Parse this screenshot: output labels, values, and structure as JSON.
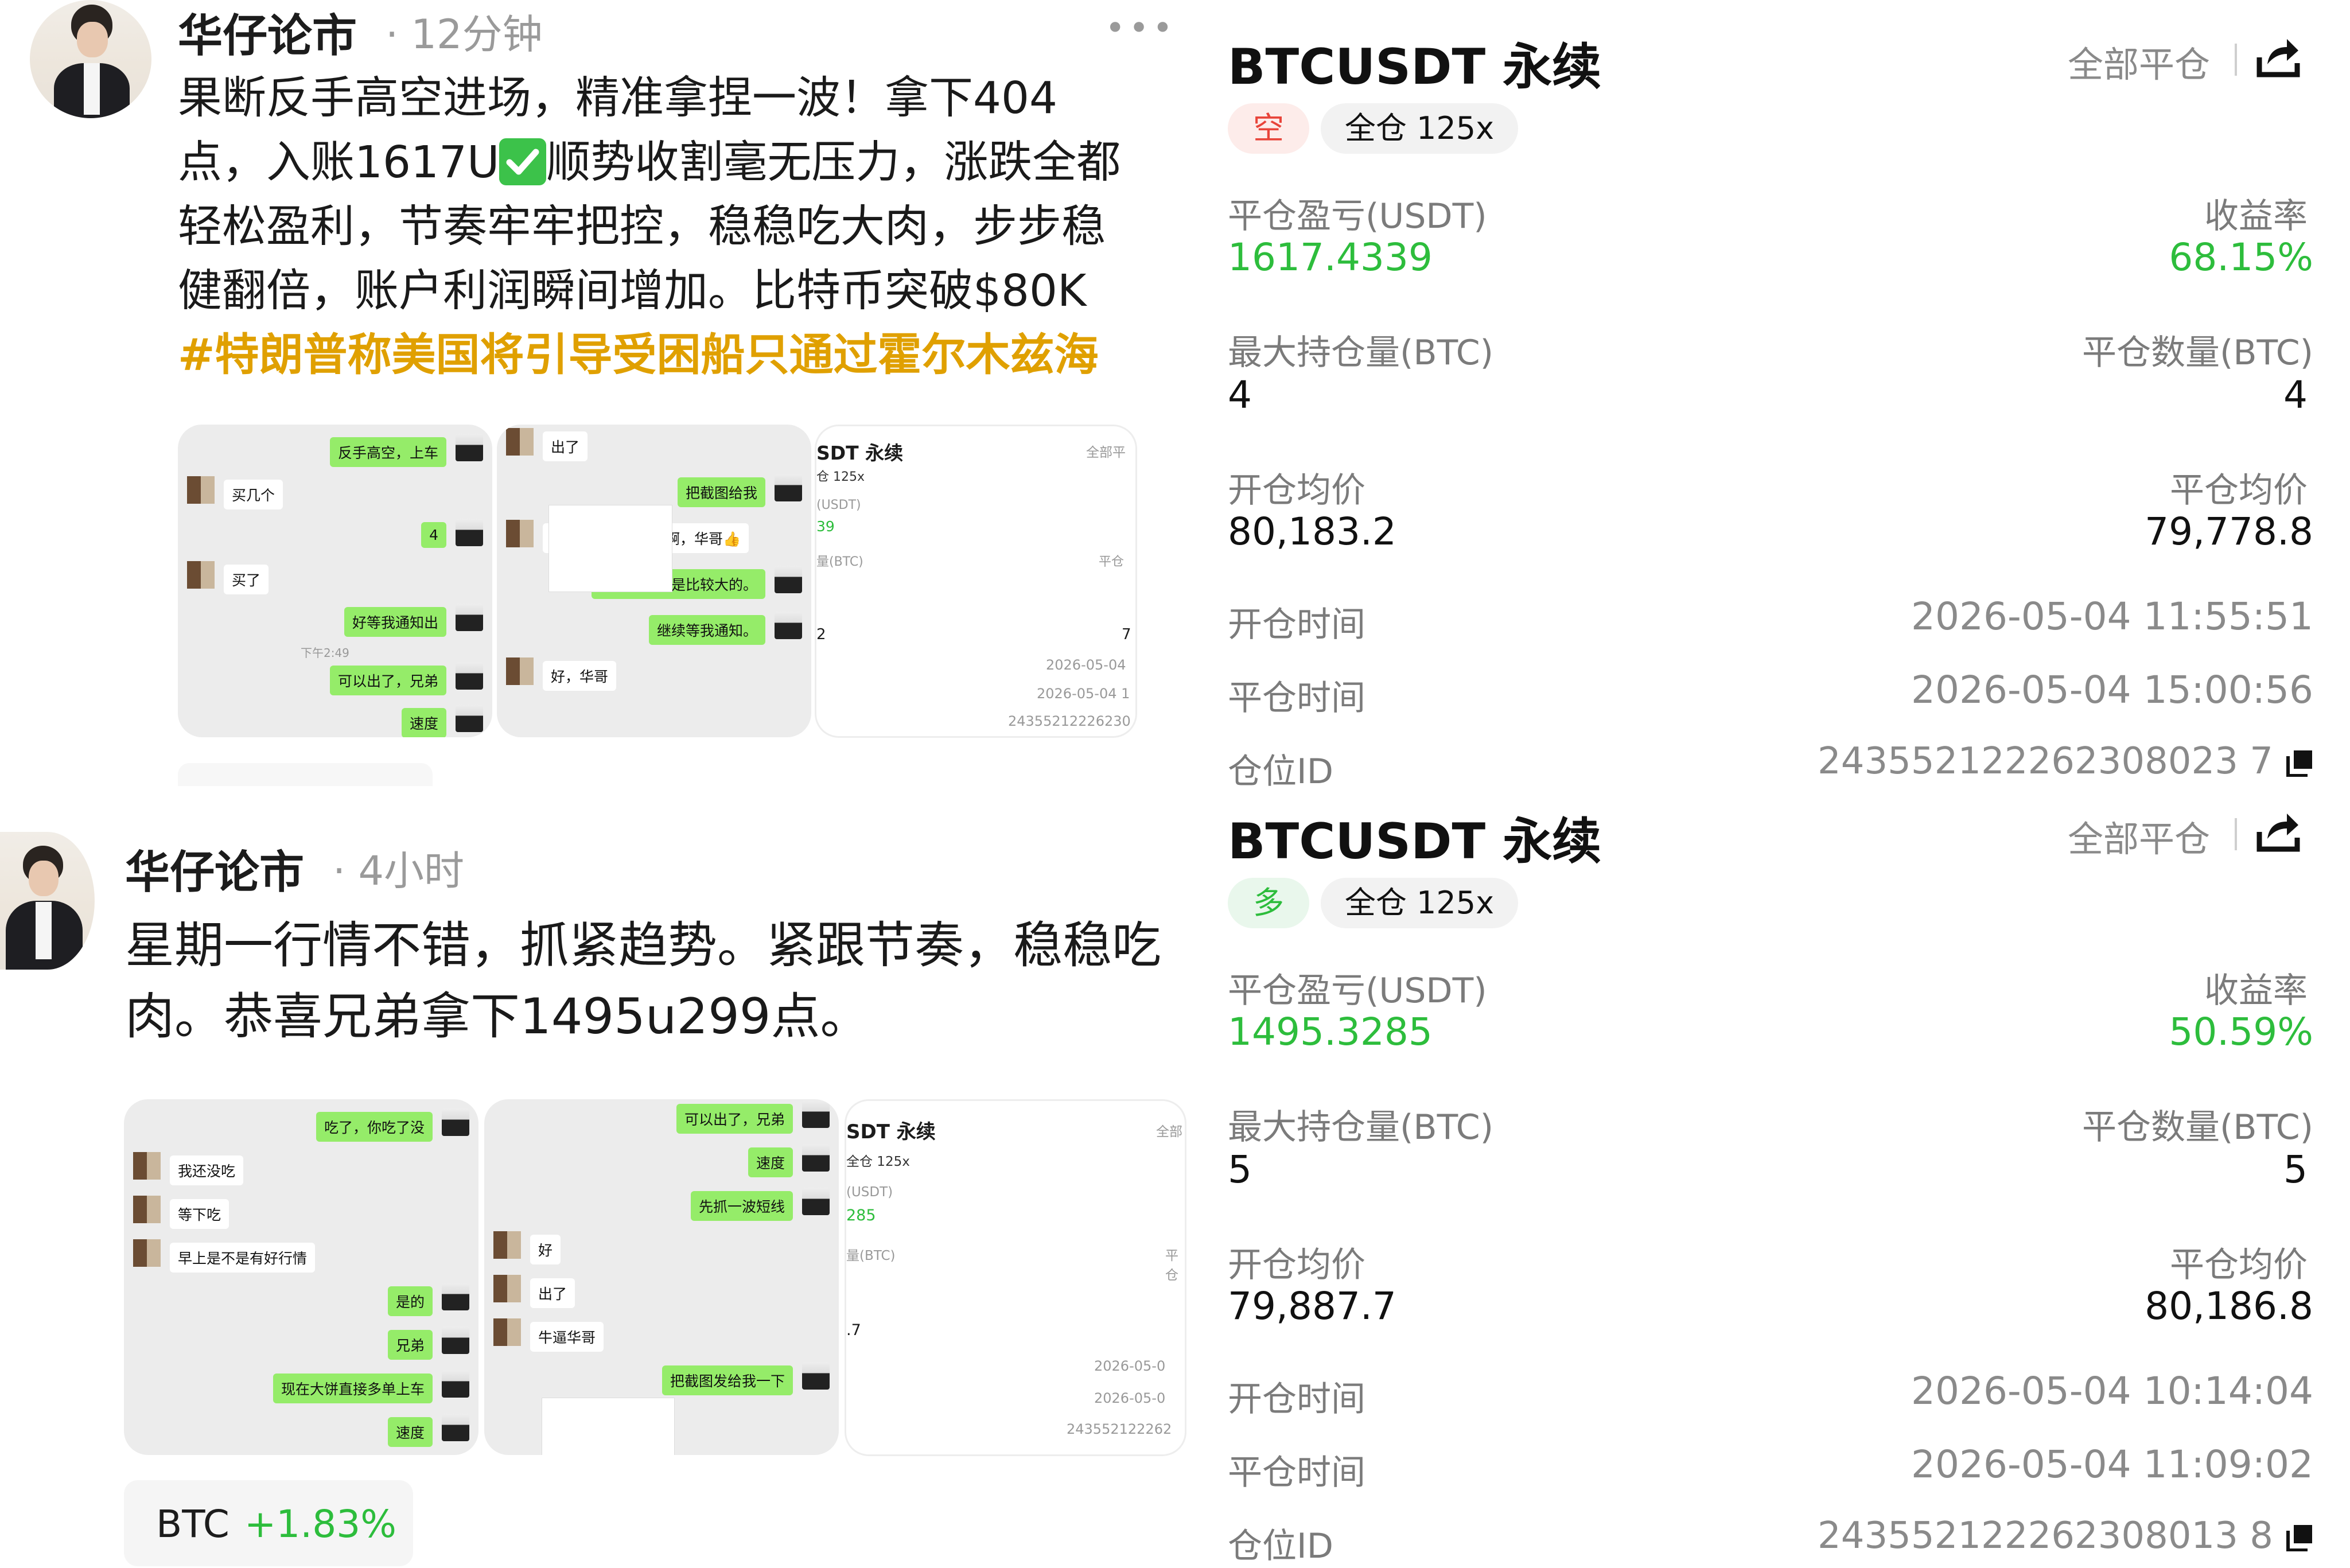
{
  "post1": {
    "author": "华仔论市",
    "time": "· 12分钟",
    "lines": [
      "果断反手高空进场，精准拿捏一波！拿下404",
      "点，入账1617U",
      "顺势收割毫无压力，涨跌全都",
      "轻松盈利，节奏牢牢把控，稳稳吃大肉，步步稳",
      "健翻倍，账户利润瞬间增加。比特币突破$80K"
    ],
    "hashtag": "#特朗普称美国将引导受困船只通过霍尔木兹海",
    "more": "•••",
    "chat1": [
      {
        "side": "g",
        "text": "反手高空，上车"
      },
      {
        "side": "w",
        "text": "买几个"
      },
      {
        "side": "g",
        "text": "4"
      },
      {
        "side": "w",
        "text": "买了"
      },
      {
        "side": "g",
        "text": "好等我通知出"
      },
      {
        "side": "t",
        "text": "下午2:49"
      },
      {
        "side": "g",
        "text": "可以出了，兄弟"
      },
      {
        "side": "g",
        "text": "速度"
      }
    ],
    "chat2": [
      {
        "side": "w",
        "text": "出了"
      },
      {
        "side": "g",
        "text": "把截图给我"
      },
      {
        "side": "w",
        "text": "猜了真的精准到位啊，华哥👍"
      },
      {
        "side": "g",
        "text": "周一行情还是比较大的。"
      },
      {
        "side": "g",
        "text": "继续等我通知。"
      },
      {
        "side": "w",
        "text": "好，华哥"
      }
    ],
    "shot3": {
      "title": "SDT 永续",
      "right": "全部平",
      "lev": "仓 125x",
      "usdt": "(USDT)",
      "num": "39",
      "btc": "量(BTC)",
      "pc": "平仓",
      "two": "2",
      "seven": "7",
      "d1": "2026-05-04",
      "d2": "2026-05-04 1",
      "id": "24355212226230"
    }
  },
  "post2": {
    "author": "华仔论市",
    "time": "· 4小时",
    "lines": [
      "星期一行情不错，抓紧趋势。紧跟节奏，稳稳吃",
      "肉。恭喜兄弟拿下1495u299点。"
    ],
    "chat1": [
      {
        "side": "g",
        "text": "吃了，你吃了没"
      },
      {
        "side": "w",
        "text": "我还没吃"
      },
      {
        "side": "w",
        "text": "等下吃"
      },
      {
        "side": "w",
        "text": "早上是不是有好行情"
      },
      {
        "side": "g",
        "text": "是的"
      },
      {
        "side": "g",
        "text": "兄弟"
      },
      {
        "side": "g",
        "text": "现在大饼直接多单上车"
      },
      {
        "side": "g",
        "text": "速度"
      }
    ],
    "chat2": [
      {
        "side": "g",
        "text": "可以出了，兄弟"
      },
      {
        "side": "g",
        "text": "速度"
      },
      {
        "side": "g",
        "text": "先抓一波短线"
      },
      {
        "side": "w",
        "text": "好"
      },
      {
        "side": "w",
        "text": "出了"
      },
      {
        "side": "w",
        "text": "牛逼华哥"
      },
      {
        "side": "g",
        "text": "把截图发给我一下"
      }
    ],
    "shot3": {
      "title": "SDT 永续",
      "right": "全部",
      "lev": "全仓 125x",
      "usdt": "(USDT)",
      "num": "285",
      "btc": "量(BTC)",
      "pc": "平仓",
      "seven": ".7",
      "d1": "2026-05-0",
      "d2": "2026-05-0",
      "id": "243552122262"
    },
    "ticker": {
      "symbol": "BTC",
      "change": "+1.83%"
    }
  },
  "cards": [
    {
      "title": "BTCUSDT 永续",
      "close_all": "全部平仓",
      "side": "空",
      "margin": "全仓 125x",
      "pnl_label": "平仓盈亏(USDT)",
      "pnl": "1617.4339",
      "roi_label": "收益率",
      "roi": "68.15%",
      "max_label": "最大持仓量(BTC)",
      "max": "4",
      "qty_label": "平仓数量(BTC)",
      "qty": "4",
      "open_avg_label": "开仓均价",
      "open_avg": "80,183.2",
      "close_avg_label": "平仓均价",
      "close_avg": "79,778.8",
      "open_time_label": "开仓时间",
      "open_time": "2026-05-04 11:55:51",
      "close_time_label": "平仓时间",
      "close_time": "2026-05-04 15:00:56",
      "id_label": "仓位ID",
      "id": "243552122262308023 7"
    },
    {
      "title": "BTCUSDT 永续",
      "close_all": "全部平仓",
      "side": "多",
      "margin": "全仓 125x",
      "pnl_label": "平仓盈亏(USDT)",
      "pnl": "1495.3285",
      "roi_label": "收益率",
      "roi": "50.59%",
      "max_label": "最大持仓量(BTC)",
      "max": "5",
      "qty_label": "平仓数量(BTC)",
      "qty": "5",
      "open_avg_label": "开仓均价",
      "open_avg": "79,887.7",
      "close_avg_label": "平仓均价",
      "close_avg": "80,186.8",
      "open_time_label": "开仓时间",
      "open_time": "2026-05-04 10:14:04",
      "close_time_label": "平仓时间",
      "close_time": "2026-05-04 11:09:02",
      "id_label": "仓位ID",
      "id": "243552122262308013 8"
    }
  ],
  "colors": {
    "green": "#2dbd3c",
    "gold": "#e0a000",
    "short_bg": "#fdecea",
    "short_fg": "#e8443a",
    "long_bg": "#e9f7ec",
    "long_fg": "#2dbd3c"
  }
}
